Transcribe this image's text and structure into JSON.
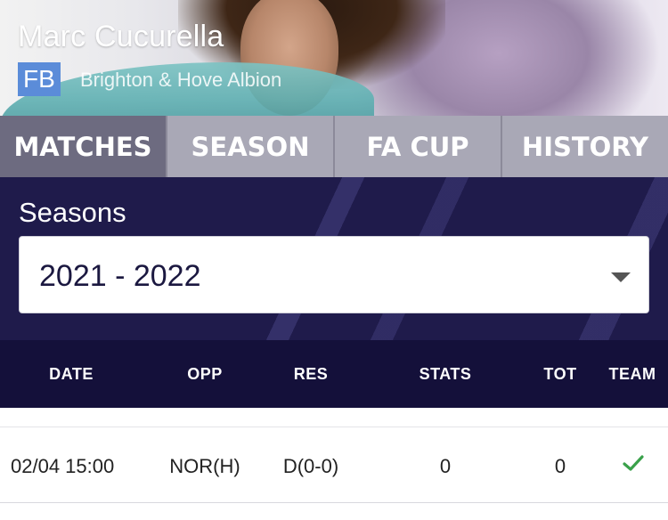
{
  "player": {
    "name": "Marc Cucurella",
    "position": "FB",
    "club": "Brighton & Hove Albion"
  },
  "tabs": [
    {
      "label": "MATCHES",
      "active": true
    },
    {
      "label": "SEASON",
      "active": false
    },
    {
      "label": "FA CUP",
      "active": false
    },
    {
      "label": "HISTORY",
      "active": false
    }
  ],
  "seasons": {
    "label": "Seasons",
    "selected": "2021 - 2022"
  },
  "table": {
    "headers": [
      "DATE",
      "OPP",
      "RES",
      "STATS",
      "TOT",
      "TEAM"
    ],
    "rows": [
      {
        "date": "02/04 15:00",
        "opp": "NOR(H)",
        "res": "D(0-0)",
        "stats": "0",
        "tot": "0",
        "team_icon": "check-icon"
      }
    ]
  },
  "colors": {
    "tab_active": "#6d6b80",
    "tab_inactive": "#a9a8b6",
    "panel_bg": "#1f1b4b",
    "header_bg": "#14103a",
    "badge": "#5b8cd9",
    "check": "#3aa14a"
  }
}
